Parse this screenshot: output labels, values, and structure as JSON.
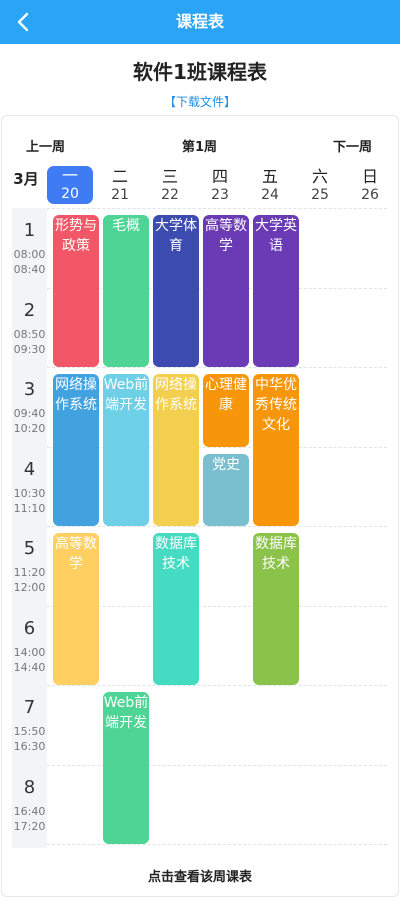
{
  "navbar": {
    "title": "课程表"
  },
  "header": {
    "title": "软件1班课程表",
    "download": "【下载文件】"
  },
  "week": {
    "prev": "上一周",
    "current": "第1周",
    "next": "下一周",
    "month": "3月"
  },
  "days": [
    {
      "wd": "一",
      "dt": "20",
      "active": true
    },
    {
      "wd": "二",
      "dt": "21"
    },
    {
      "wd": "三",
      "dt": "22"
    },
    {
      "wd": "四",
      "dt": "23"
    },
    {
      "wd": "五",
      "dt": "24"
    },
    {
      "wd": "六",
      "dt": "25"
    },
    {
      "wd": "日",
      "dt": "26"
    }
  ],
  "slots": [
    {
      "n": "1",
      "start": "08:00",
      "end": "08:40"
    },
    {
      "n": "2",
      "start": "08:50",
      "end": "09:30"
    },
    {
      "n": "3",
      "start": "09:40",
      "end": "10:20"
    },
    {
      "n": "4",
      "start": "10:30",
      "end": "11:10"
    },
    {
      "n": "5",
      "start": "11:20",
      "end": "12:00"
    },
    {
      "n": "6",
      "start": "14:00",
      "end": "14:40"
    },
    {
      "n": "7",
      "start": "15:50",
      "end": "16:30"
    },
    {
      "n": "8",
      "start": "16:40",
      "end": "17:20"
    }
  ],
  "courses": [
    {
      "name": "形势与政策",
      "day": 1,
      "start": 1,
      "span": 2,
      "color": "#f25767"
    },
    {
      "name": "毛概",
      "day": 2,
      "start": 1,
      "span": 2,
      "color": "#4ed495"
    },
    {
      "name": "大学体育",
      "day": 3,
      "start": 1,
      "span": 2,
      "color": "#3b4bb0"
    },
    {
      "name": "高等数学",
      "day": 4,
      "start": 1,
      "span": 2,
      "color": "#6a3bb5"
    },
    {
      "name": "大学英语",
      "day": 5,
      "start": 1,
      "span": 2,
      "color": "#6a3bb5"
    },
    {
      "name": "网络操作系统",
      "day": 1,
      "start": 3,
      "span": 2,
      "color": "#42a2e0"
    },
    {
      "name": "Web前端开发",
      "day": 2,
      "start": 3,
      "span": 2,
      "color": "#6dd0e6"
    },
    {
      "name": "网络操作系统",
      "day": 3,
      "start": 3,
      "span": 2,
      "color": "#f2cf4f"
    },
    {
      "name": "心理健康",
      "day": 4,
      "start": 3,
      "span": 1,
      "color": "#f7960a"
    },
    {
      "name": "中华优秀传统文化",
      "day": 5,
      "start": 3,
      "span": 2,
      "color": "#f7960a"
    },
    {
      "name": "党史",
      "day": 4,
      "start": 4,
      "span": 1,
      "color": "#79bfd0"
    },
    {
      "name": "高等数学",
      "day": 1,
      "start": 5,
      "span": 2,
      "color": "#ffd061"
    },
    {
      "name": "数据库技术",
      "day": 3,
      "start": 5,
      "span": 2,
      "color": "#45dac2"
    },
    {
      "name": "数据库技术",
      "day": 5,
      "start": 5,
      "span": 2,
      "color": "#8bc34a"
    },
    {
      "name": "Web前端开发",
      "day": 2,
      "start": 7,
      "span": 2,
      "color": "#4ed495"
    }
  ],
  "footer": {
    "text": "点击查看该周课表"
  }
}
